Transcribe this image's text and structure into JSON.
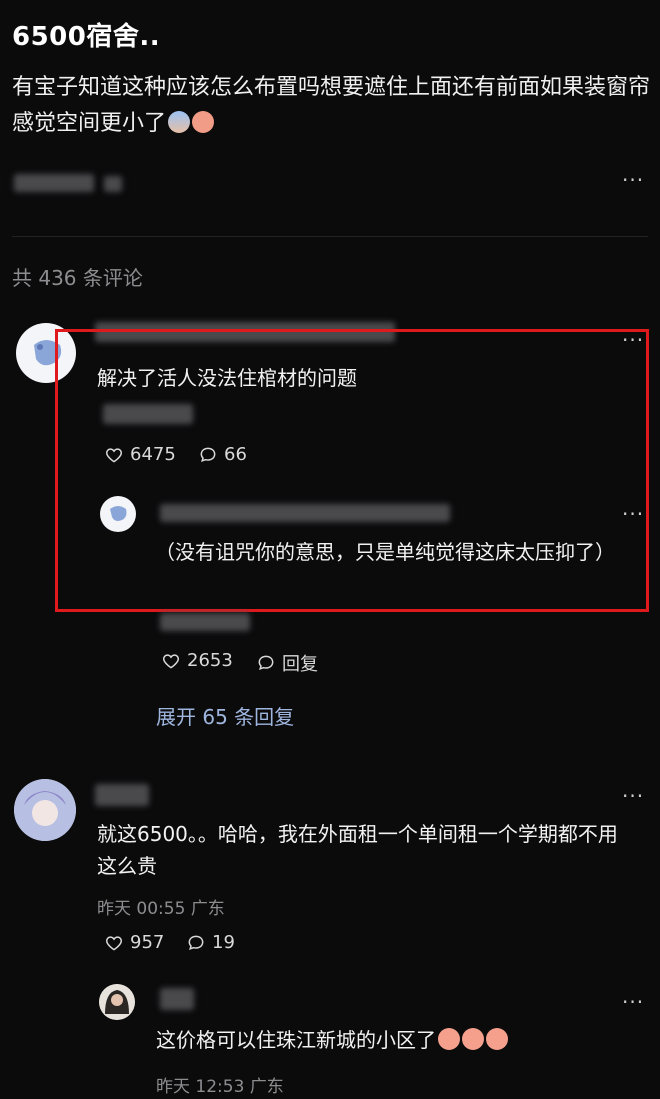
{
  "post": {
    "title": "6500宿舍..",
    "body": "有宝子知道这种应该怎么布置吗想要遮住上面还有前面如果装窗帘感觉空间更小了",
    "more": "···"
  },
  "comments_header": {
    "count_label": "共 436 条评论"
  },
  "comments": [
    {
      "text": "解决了活人没法住棺材的问题",
      "likes": "6475",
      "replies_count": "66",
      "more": "···",
      "reply": {
        "text": "（没有诅咒你的意思，只是单纯觉得这床太压抑了）",
        "likes": "2653",
        "reply_label": "回复",
        "more": "···"
      },
      "expand_label": "展开 65 条回复"
    },
    {
      "text": "就这6500。。哈哈，我在外面租一个单间租一个学期都不用这么贵",
      "time": "昨天 00:55",
      "location": "广东",
      "likes": "957",
      "replies_count": "19",
      "more": "···",
      "reply": {
        "text": "这价格可以住珠江新城的小区了",
        "time": "昨天 12:53",
        "location": "广东",
        "more": "···"
      }
    }
  ],
  "colors": {
    "highlight": "#e0191d",
    "link": "#9fb6df",
    "meta": "#8d8d90"
  }
}
